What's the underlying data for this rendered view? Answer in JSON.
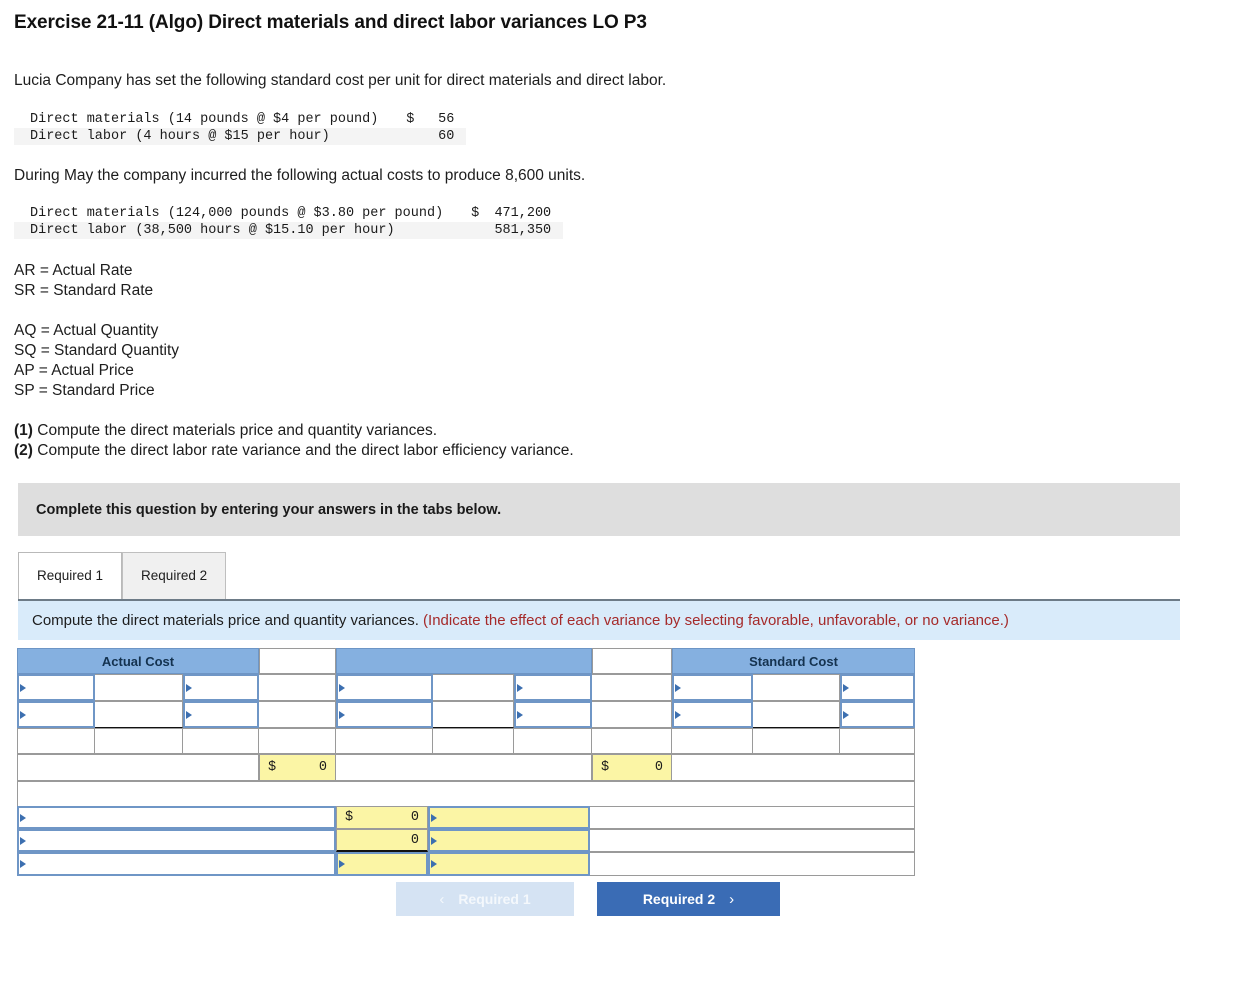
{
  "exercise": {
    "title": "Exercise 21-11 (Algo) Direct materials and direct labor variances LO P3",
    "intro_1": "Lucia Company has set the following standard cost per unit for direct materials and direct labor.",
    "intro_2": "During May the company incurred the following actual costs to produce 8,600 units."
  },
  "standard_cost_table": {
    "rows": [
      {
        "label": "Direct materials (14 pounds @ $4 per pound)",
        "dollar": "$",
        "amount": "56"
      },
      {
        "label": "Direct labor (4 hours @ $15 per hour)",
        "dollar": "",
        "amount": "60"
      }
    ]
  },
  "actual_cost_table": {
    "rows": [
      {
        "label": "Direct materials (124,000 pounds @ $3.80 per pound)",
        "dollar": "$",
        "amount": "471,200"
      },
      {
        "label": "Direct labor (38,500 hours @ $15.10 per hour)",
        "dollar": "",
        "amount": "581,350"
      }
    ]
  },
  "abbreviations_group_1": [
    "AR = Actual Rate",
    "SR = Standard Rate"
  ],
  "abbreviations_group_2": [
    "AQ = Actual Quantity",
    "SQ = Standard Quantity",
    "AP = Actual Price",
    "SP = Standard Price"
  ],
  "requirements": [
    {
      "num": "(1)",
      "text": " Compute the direct materials price and quantity variances."
    },
    {
      "num": "(2)",
      "text": " Compute the direct labor rate variance and the direct labor efficiency variance."
    }
  ],
  "complete_bar": {
    "text": "Complete this question by entering your answers in the tabs below."
  },
  "tabs": [
    {
      "label": "Required 1",
      "active": true
    },
    {
      "label": "Required 2",
      "active": false
    }
  ],
  "prompt": {
    "black_text": "Compute the direct materials price and quantity variances.",
    "red_text": "(Indicate the effect of each variance by selecting favorable, unfavorable, or no variance.)"
  },
  "answer_grid": {
    "headers": {
      "actual_cost": "Actual Cost",
      "middle": "",
      "standard_cost": "Standard Cost"
    },
    "dropdowns_empty_value": "",
    "totals": {
      "actual_total_dollar": "$",
      "actual_total_value": "0",
      "standard_total_dollar": "$",
      "standard_total_value": "0"
    },
    "variance_rows": [
      {
        "label": "",
        "dollar": "$",
        "value": "0",
        "effect": ""
      },
      {
        "label": "",
        "dollar": "",
        "value": "0",
        "effect": ""
      },
      {
        "label": "",
        "dollar": "",
        "value": "",
        "effect": ""
      }
    ]
  },
  "nav": {
    "prev_label": "Required 1",
    "prev_chevron": "‹",
    "next_label": "Required 2",
    "next_chevron": "›"
  },
  "colors": {
    "header_blue": "#85b0e0",
    "input_yellow": "#fbf5a5",
    "prompt_blue": "#d9ebfa",
    "grey_bar": "#dedede",
    "red_text": "#a52a2a",
    "primary_button": "#3a6cb5",
    "disabled_button": "#d5e3f3"
  }
}
